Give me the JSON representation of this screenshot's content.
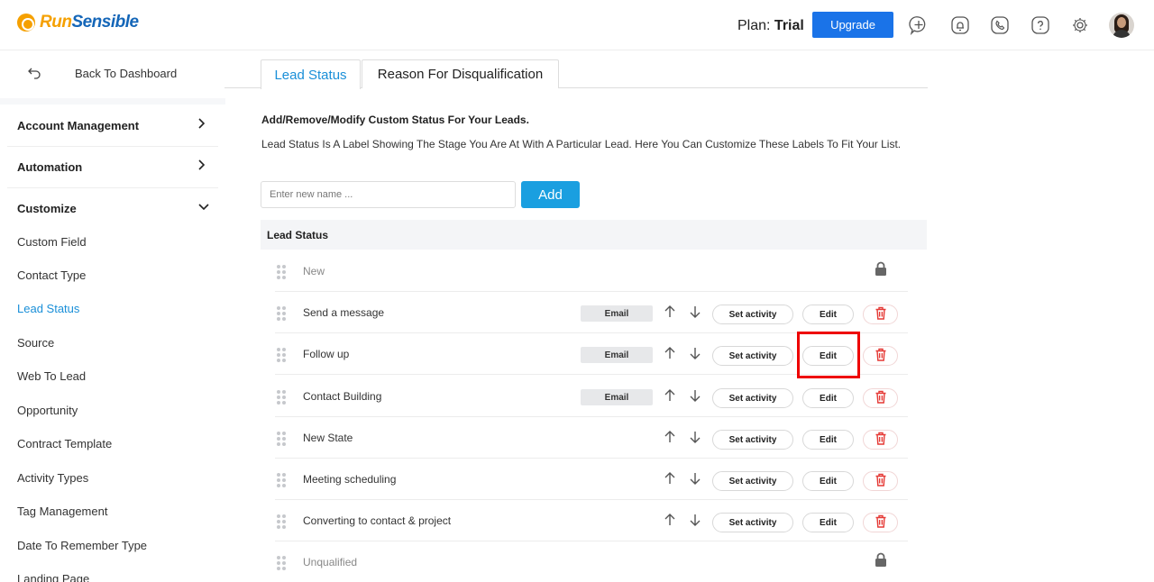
{
  "header": {
    "logo_run": "Run",
    "logo_sensible": "Sensible",
    "plan_label": "Plan:",
    "plan_value": "Trial",
    "upgrade_label": "Upgrade"
  },
  "sidebar": {
    "back_label": "Back To Dashboard",
    "sections": [
      {
        "label": "Account Management",
        "expanded": false
      },
      {
        "label": "Automation",
        "expanded": false
      },
      {
        "label": "Customize",
        "expanded": true
      }
    ],
    "items": [
      {
        "label": "Custom Field",
        "active": false
      },
      {
        "label": "Contact Type",
        "active": false
      },
      {
        "label": "Lead Status",
        "active": true
      },
      {
        "label": "Source",
        "active": false
      },
      {
        "label": "Web To Lead",
        "active": false
      },
      {
        "label": "Opportunity",
        "active": false
      },
      {
        "label": "Contract Template",
        "active": false
      },
      {
        "label": "Activity Types",
        "active": false
      },
      {
        "label": "Tag Management",
        "active": false
      },
      {
        "label": "Date To Remember Type",
        "active": false
      },
      {
        "label": "Landing Page",
        "active": false
      }
    ]
  },
  "tabs": [
    {
      "label": "Lead Status",
      "active": true
    },
    {
      "label": "Reason For Disqualification",
      "active": false
    }
  ],
  "main": {
    "heading": "Add/Remove/Modify Custom Status For Your Leads.",
    "description": "Lead Status Is A Label Showing The Stage You Are At With A Particular Lead. Here You Can Customize These Labels To Fit Your List.",
    "input_placeholder": "Enter new name ...",
    "add_label": "Add",
    "table_header": "Lead Status",
    "email_label": "Email",
    "set_activity_label": "Set activity",
    "edit_label": "Edit"
  },
  "rows": [
    {
      "name": "New",
      "locked": true,
      "email": false
    },
    {
      "name": "Send a message",
      "locked": false,
      "email": true
    },
    {
      "name": "Follow up",
      "locked": false,
      "email": true,
      "highlighted": true
    },
    {
      "name": "Contact Building",
      "locked": false,
      "email": true
    },
    {
      "name": "New State",
      "locked": false,
      "email": false
    },
    {
      "name": "Meeting scheduling",
      "locked": false,
      "email": false
    },
    {
      "name": "Converting to contact & project",
      "locked": false,
      "email": false
    },
    {
      "name": "Unqualified",
      "locked": true,
      "email": false
    }
  ],
  "colors": {
    "brand_blue": "#1a73e8",
    "accent_blue": "#1a8fd8",
    "logo_orange": "#f5a000",
    "delete_red": "#e53935",
    "highlight_red": "#ee0000"
  }
}
